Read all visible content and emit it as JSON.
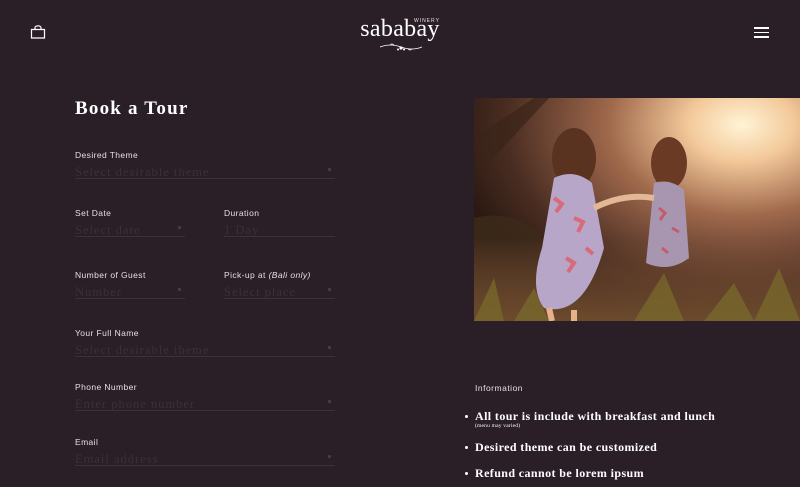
{
  "header": {
    "logo_text": "sababay",
    "logo_sub": "WINERY",
    "cart_icon": "shopping-bag-icon",
    "menu_icon": "hamburger-menu-icon"
  },
  "form": {
    "title": "Book a Tour",
    "theme": {
      "label": "Desired Theme",
      "placeholder": "Select desirable theme"
    },
    "date": {
      "label": "Set Date",
      "placeholder": "Select date"
    },
    "duration": {
      "label": "Duration",
      "placeholder": "1 Day"
    },
    "guests": {
      "label": "Number of Guest",
      "placeholder": "Number"
    },
    "pickup": {
      "label": "Pick-up at",
      "label_note": "(Bali only)",
      "placeholder": "Select place"
    },
    "full_name": {
      "label": "Your Full Name",
      "placeholder": "Select desirable theme"
    },
    "phone": {
      "label": "Phone Number",
      "placeholder": "Enter phone number"
    },
    "email": {
      "label": "Email",
      "placeholder": "Email address"
    }
  },
  "info": {
    "heading": "Information",
    "items": [
      {
        "text": "All tour is include with breakfast and lunch",
        "note": "(menu may varied)"
      },
      {
        "text": "Desired theme can be customized"
      },
      {
        "text": "Refund cannot be lorem ipsum"
      }
    ]
  },
  "colors": {
    "background": "#2b1f27",
    "text": "#ffffff",
    "muted": "#3c2f37"
  }
}
